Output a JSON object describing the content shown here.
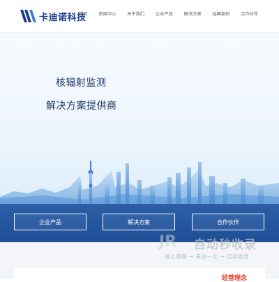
{
  "header": {
    "brand": "卡迪诺科技",
    "logo_icon": "kadino-logo-icon",
    "nav": [
      "首页",
      "新闻中心",
      "关于我们",
      "企业产品",
      "解决方案",
      "经典案例",
      "合作伙伴"
    ]
  },
  "hero": {
    "line1": "核辐射监测",
    "line2": "解决方案提供商",
    "buttons": [
      "企业产品",
      "解决方案",
      "合作伙伴"
    ]
  },
  "lower": {
    "tag": "经营理念"
  },
  "watermark": {
    "logo": "JR",
    "main": "自动秒收录",
    "sub": "做上链接 → 来访一次 → 自动收录"
  },
  "colors": {
    "brand": "#1b3c8c",
    "band": "#1f4f96",
    "accent_red": "#e1402b"
  }
}
